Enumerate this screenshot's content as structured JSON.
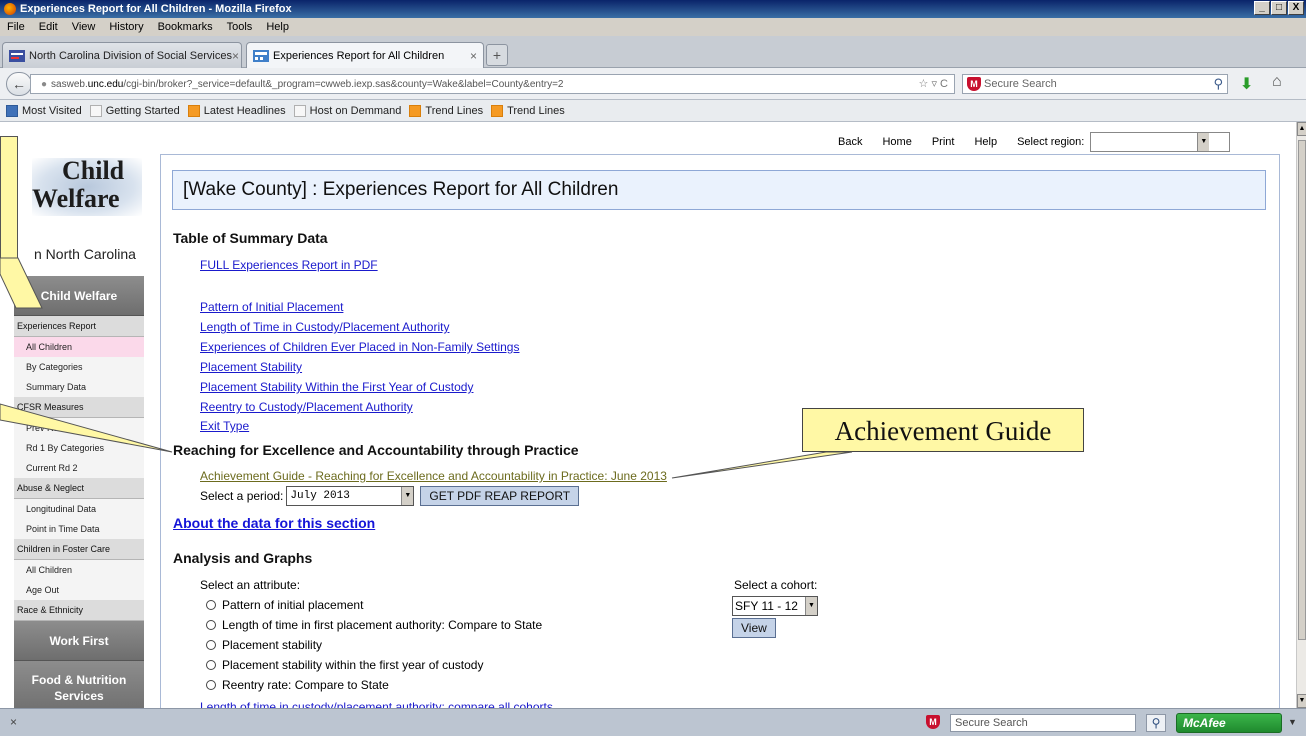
{
  "window": {
    "title": "Experiences Report for All Children - Mozilla Firefox",
    "controls": [
      "_",
      "□",
      "X"
    ]
  },
  "menu": [
    "File",
    "Edit",
    "View",
    "History",
    "Bookmarks",
    "Tools",
    "Help"
  ],
  "tabs": [
    {
      "label": "North Carolina Division of Social Services",
      "active": false,
      "close": "×"
    },
    {
      "label": "Experiences Report for All Children",
      "active": true,
      "close": "×"
    }
  ],
  "new_tab": "+",
  "nav": {
    "url_prefix": "sasweb.",
    "url_domain": "unc.edu",
    "url_rest": "/cgi-bin/broker?_service=default&_program=cwweb.iexp.sas&county=Wake&label=County&entry=2",
    "url_tools": "☆ ▿ C",
    "search_placeholder": "Secure Search"
  },
  "bookmarks": [
    {
      "label": "Most Visited",
      "icon": "most-visited-icon"
    },
    {
      "label": "Getting Started",
      "icon": "page-icon"
    },
    {
      "label": "Latest Headlines",
      "icon": "rss-icon"
    },
    {
      "label": "Host on Demmand",
      "icon": "page-icon"
    },
    {
      "label": "Trend Lines",
      "icon": "rss-icon"
    },
    {
      "label": "Trend Lines",
      "icon": "rss-icon"
    }
  ],
  "topnav": {
    "links": [
      "Back",
      "Home",
      "Print",
      "Help"
    ],
    "region_label": "Select region:"
  },
  "logo": {
    "line1": "Child",
    "line2": "Welfare",
    "tagline": "n North Carolina"
  },
  "sidebar": {
    "child_welfare": "Child Welfare",
    "experiences_report": "Experiences Report",
    "all_children": "All Children",
    "by_categories": "By Categories",
    "summary_data": "Summary Data",
    "cfsr_measures": "CFSR Measures",
    "prev_rd1": "Prev Rd 1",
    "rd1_by_categories": "Rd 1 By Categories",
    "current_rd2": "Current Rd 2",
    "abuse_neglect": "Abuse & Neglect",
    "longitudinal": "Longitudinal Data",
    "point_in_time": "Point in Time Data",
    "foster_care": "Children in Foster Care",
    "fc_all_children": "All Children",
    "age_out": "Age Out",
    "race_ethnicity": "Race & Ethnicity",
    "work_first": "Work First",
    "food_nutrition_1": "Food & Nutrition",
    "food_nutrition_2": "Services"
  },
  "main": {
    "title": "[Wake County] : Experiences Report for All Children",
    "summary_heading": "Table of Summary Data",
    "full_pdf": "FULL Experiences Report in PDF",
    "links": [
      "Pattern of Initial Placement",
      "Length of Time in Custody/Placement Authority",
      "Experiences of Children Ever Placed in Non-Family Settings",
      "Placement Stability",
      "Placement Stability Within the First Year of Custody",
      "Reentry to Custody/Placement Authority",
      "Exit Type"
    ],
    "reap_heading": "Reaching for Excellence and Accountability through Practice",
    "achievement_link": "Achievement Guide - Reaching for Excellence and Accountability in Practice: June 2013",
    "period_label": "Select a period:",
    "period_value": "July 2013",
    "reap_button": "GET PDF REAP REPORT",
    "about_link": "About the data for this section",
    "analysis_heading": "Analysis and Graphs",
    "attribute_label": "Select an attribute:",
    "attributes": [
      "Pattern of initial placement",
      "Length of time in first placement authority: Compare to State",
      "Placement stability",
      "Placement stability within the first year of custody",
      "Reentry rate: Compare to State"
    ],
    "compare_link": "Length of time in custody/placement authority: compare all cohorts",
    "cohort_label": "Select a cohort:",
    "cohort_value": "SFY 11 - 12",
    "view_button": "View"
  },
  "callout": {
    "text": "Achievement Guide"
  },
  "status": {
    "close": "×",
    "search_placeholder": "Secure Search",
    "mcafee": "McAfee"
  },
  "colors": {
    "link": "#1a1acc",
    "olive_link": "#6c6b1e",
    "callout": "#fff8a5",
    "title_bg": "#eaf2fd",
    "sidebar_head": "#7a7a7a",
    "active_item": "#fbd9ea"
  }
}
